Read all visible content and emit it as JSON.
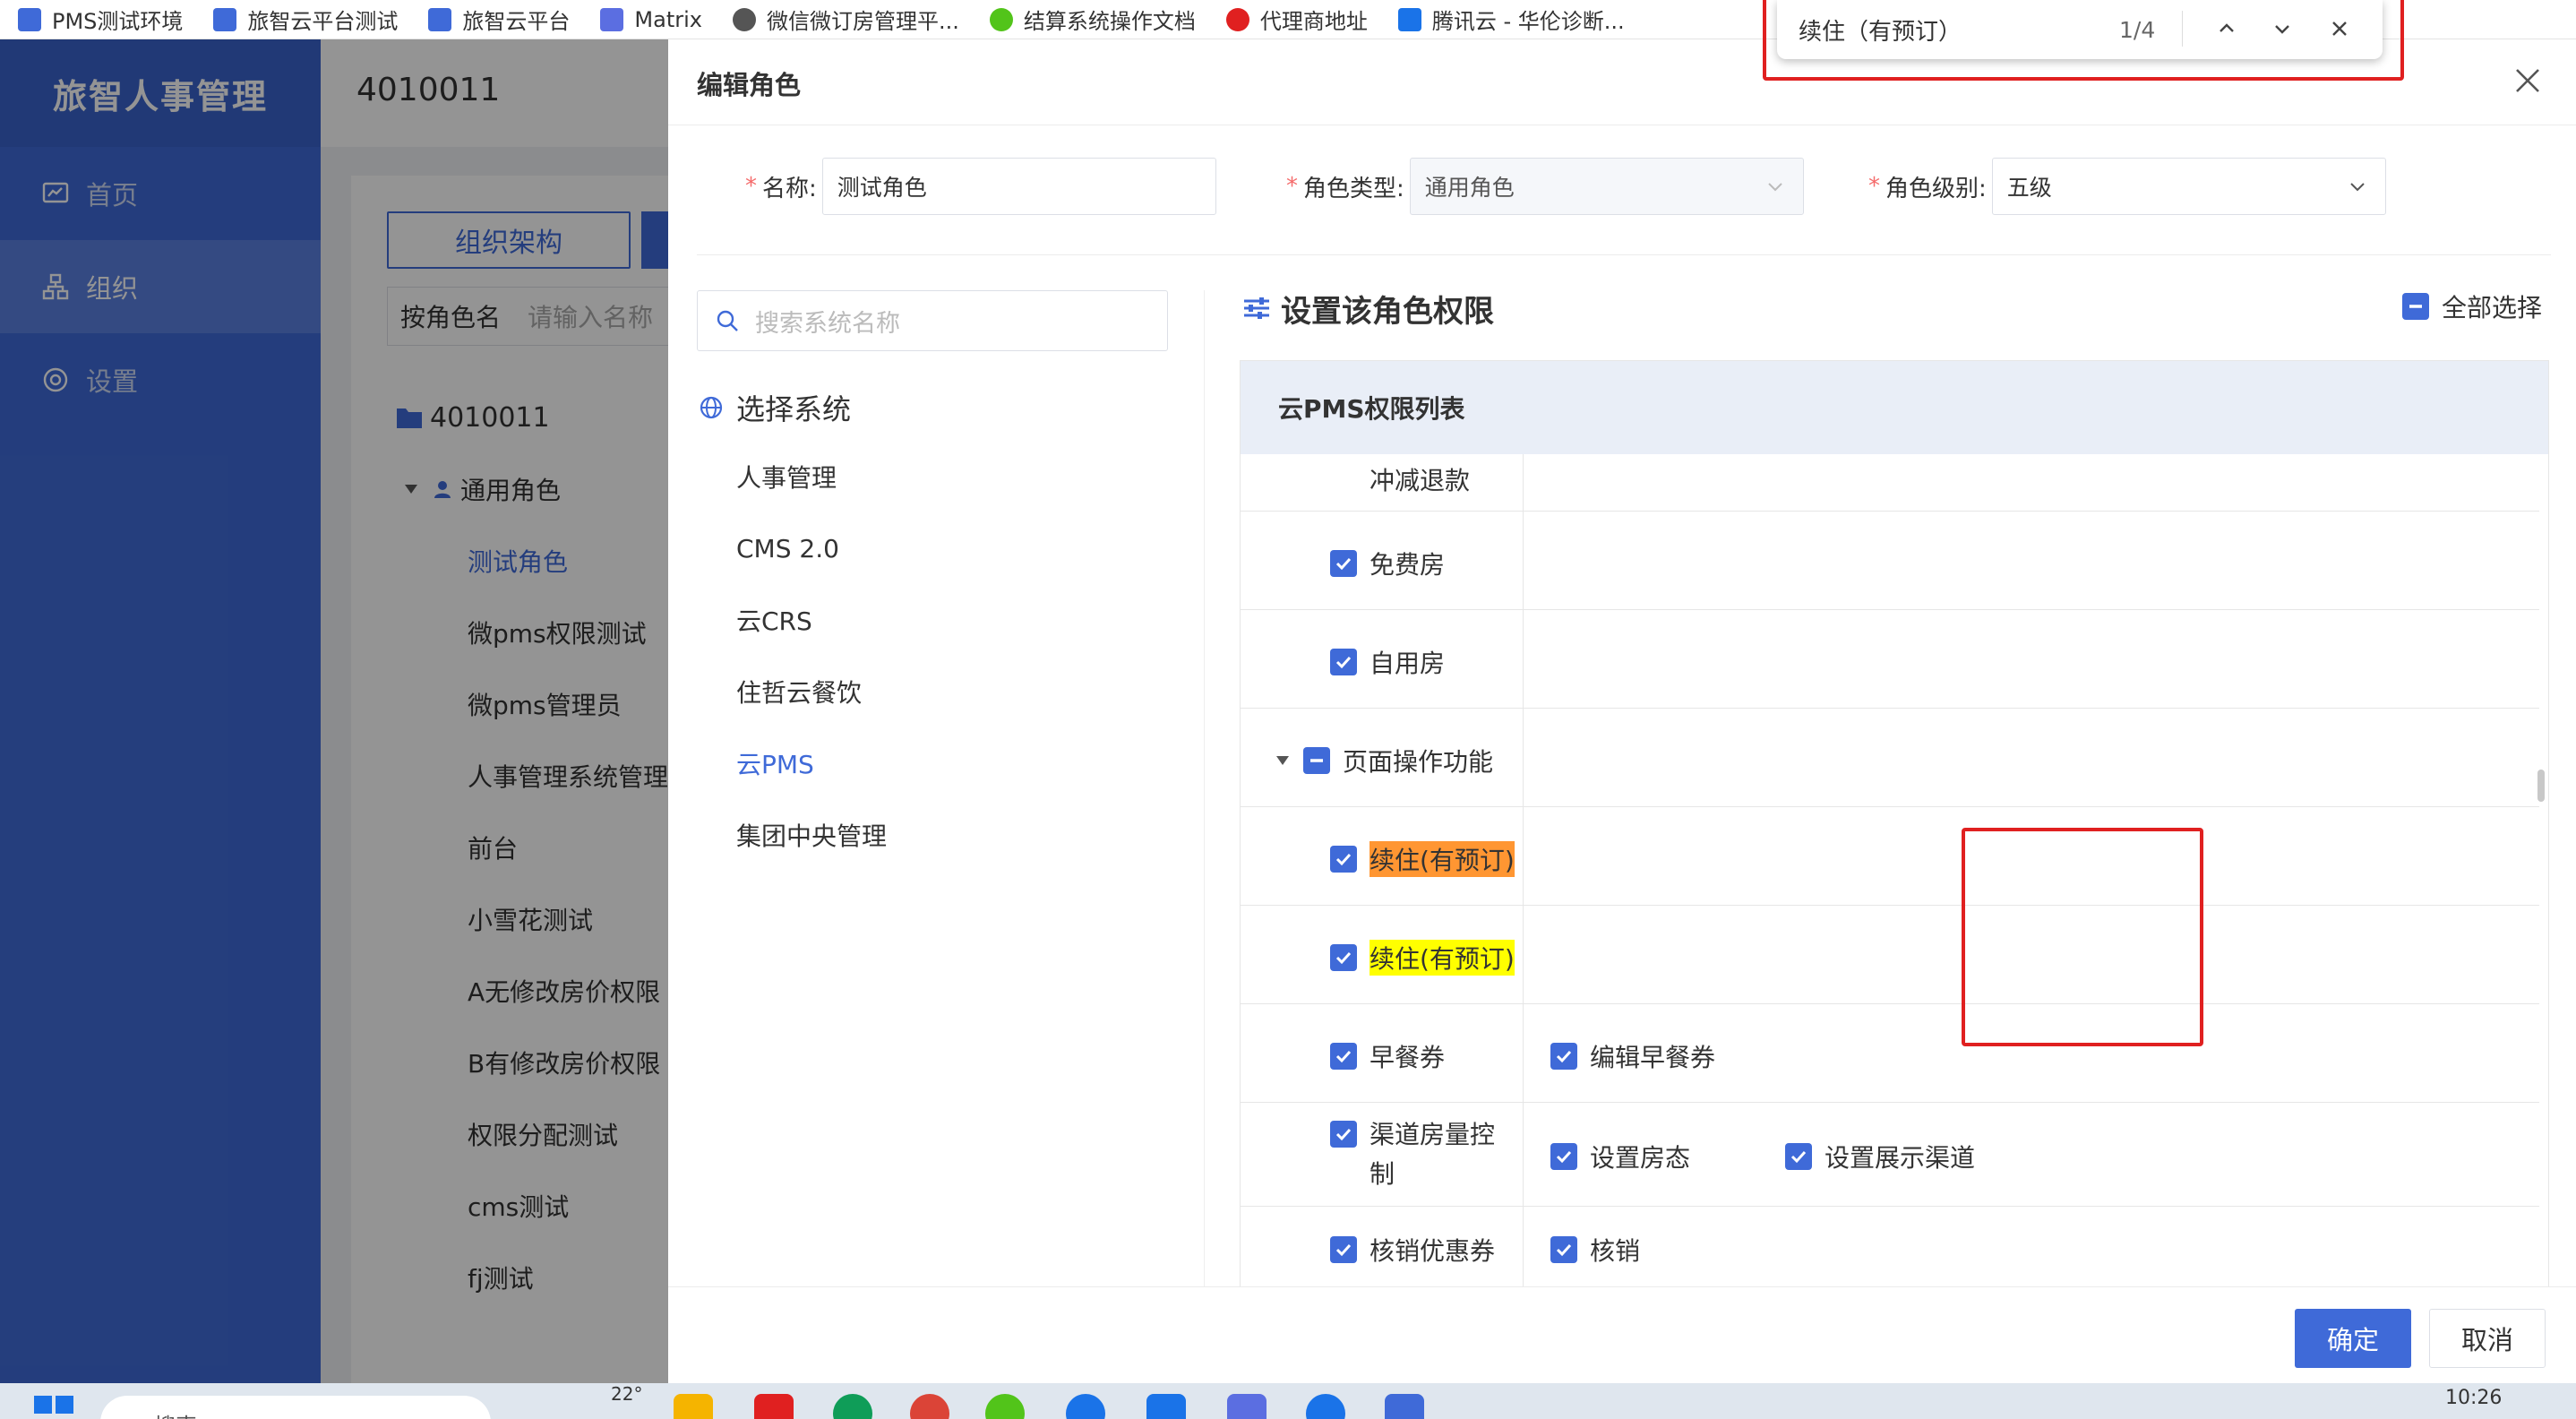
{
  "bookmarks": [
    {
      "label": "PMS测试环境",
      "color": "#3f6ad8"
    },
    {
      "label": "旅智云平台测试",
      "color": "#3f6ad8"
    },
    {
      "label": "旅智云平台",
      "color": "#3f6ad8"
    },
    {
      "label": "Matrix",
      "color": "#5b6ee1"
    },
    {
      "label": "微信微订房管理平...",
      "color": "#555555"
    },
    {
      "label": "结算系统操作文档",
      "color": "#52c41a"
    },
    {
      "label": "代理商地址",
      "color": "#e02020"
    },
    {
      "label": "腾讯云 - 华伦诊断...",
      "color": "#1a73e8"
    }
  ],
  "sidebar": {
    "title": "旅智人事管理",
    "items": [
      {
        "label": "首页",
        "icon": "dashboard-icon"
      },
      {
        "label": "组织",
        "icon": "org-chart-icon"
      },
      {
        "label": "设置",
        "icon": "settings-icon"
      }
    ]
  },
  "background": {
    "header_code": "4010011",
    "org_button": "组织架构",
    "search_select": "按角色名",
    "search_placeholder": "请输入名称",
    "tree_root": "4010011",
    "tree_group": "通用角色",
    "tree_items": [
      "测试角色",
      "微pms权限测试",
      "微pms管理员",
      "人事管理系统管理",
      "前台",
      "小雪花测试",
      "A无修改房价权限",
      "B有修改房价权限",
      "权限分配测试",
      "cms测试",
      "fj测试"
    ]
  },
  "dialog": {
    "title": "编辑角色",
    "name_label": "名称:",
    "name_value": "测试角色",
    "type_label": "角色类型:",
    "type_value": "通用角色",
    "level_label": "角色级别:",
    "level_value": "五级",
    "system_search_placeholder": "搜索系统名称",
    "system_title": "选择系统",
    "systems": [
      "人事管理",
      "CMS 2.0",
      "云CRS",
      "住哲云餐饮",
      "云PMS",
      "集团中央管理"
    ],
    "selected_system": "云PMS",
    "perm_title": "设置该角色权限",
    "select_all": "全部选择",
    "perm_table_title": "云PMS权限列表",
    "perm_rows": {
      "r0": "冲减退款",
      "r1": "免费房",
      "r2": "自用房",
      "r3": "页面操作功能",
      "r4": "续住(有预订)",
      "r5": "续住(有预订)",
      "r6": "早餐券",
      "r6b": "编辑早餐券",
      "r7": "渠道房量控制",
      "r7b": "设置房态",
      "r7c": "设置展示渠道",
      "r8": "核销优惠券",
      "r8b": "核销"
    },
    "ok_button": "确定",
    "cancel_button": "取消"
  },
  "findbar": {
    "query": "续住（有预订）",
    "count": "1/4"
  },
  "taskbar": {
    "search": "搜索",
    "temperature": "22°",
    "time": "10:26"
  },
  "colors": {
    "brand": "#3f6ad8",
    "highlight_current": "#ff9632",
    "highlight_match": "#ffff00",
    "annotation": "#e02020"
  }
}
